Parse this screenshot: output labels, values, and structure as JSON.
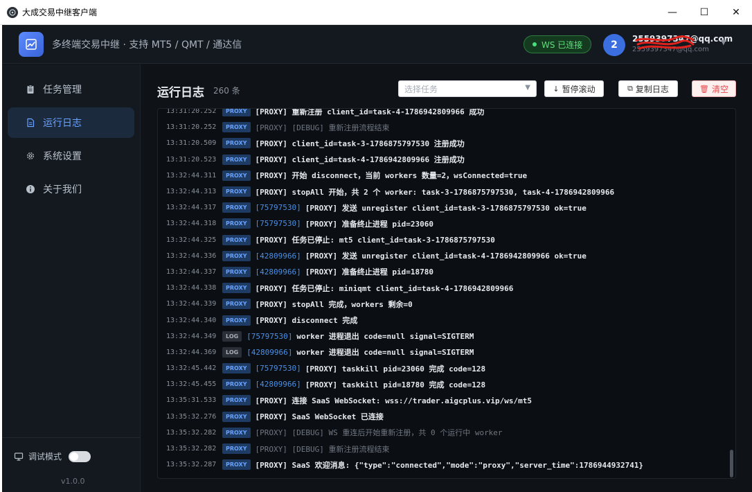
{
  "window": {
    "title": "大成交易中继客户端",
    "controls": [
      "—",
      "☐",
      "✕"
    ]
  },
  "header": {
    "title": "多终端交易中继 · 支持 MT5 / QMT / 通达信",
    "ws_status": "WS 已连接",
    "avatar_text": "2",
    "email_primary": "2559397347@qq.com",
    "email_secondary": "2559397347@qq.com"
  },
  "sidebar": {
    "items": [
      {
        "label": "任务管理",
        "icon": "clipboard-icon",
        "active": false
      },
      {
        "label": "运行日志",
        "icon": "document-icon",
        "active": true
      },
      {
        "label": "系统设置",
        "icon": "gear-icon",
        "active": false
      },
      {
        "label": "关于我们",
        "icon": "info-icon",
        "active": false
      }
    ],
    "debug_label": "调试模式",
    "debug_enabled": false,
    "version": "v1.0.0"
  },
  "main": {
    "title": "运行日志",
    "count": "260 条",
    "task_select_placeholder": "选择任务",
    "pause_label": "暂停滚动",
    "copy_label": "复制日志",
    "clear_label": "清空"
  },
  "logs": [
    {
      "time": "13:31:20.252",
      "tag": "PROXY",
      "src": "",
      "msg": "[PROXY] 重新注册 client_id=task-4-1786942809966 成功",
      "dim": false
    },
    {
      "time": "13:31:20.252",
      "tag": "PROXY",
      "src": "",
      "msg": "[PROXY] [DEBUG] 重新注册流程结束",
      "dim": true
    },
    {
      "time": "13:31:20.509",
      "tag": "PROXY",
      "src": "",
      "msg": "[PROXY] client_id=task-3-1786875797530 注册成功",
      "dim": false
    },
    {
      "time": "13:31:20.523",
      "tag": "PROXY",
      "src": "",
      "msg": "[PROXY] client_id=task-4-1786942809966 注册成功",
      "dim": false
    },
    {
      "time": "13:32:44.311",
      "tag": "PROXY",
      "src": "",
      "msg": "[PROXY] 开始 disconnect，当前 workers 数量=2，wsConnected=true",
      "dim": false
    },
    {
      "time": "13:32:44.313",
      "tag": "PROXY",
      "src": "",
      "msg": "[PROXY] stopAll 开始，共 2 个 worker: task-3-1786875797530, task-4-1786942809966",
      "dim": false
    },
    {
      "time": "13:32:44.317",
      "tag": "PROXY",
      "src": "[75797530]",
      "msg": "[PROXY] 发送 unregister client_id=task-3-1786875797530 ok=true",
      "dim": false
    },
    {
      "time": "13:32:44.318",
      "tag": "PROXY",
      "src": "[75797530]",
      "msg": "[PROXY] 准备终止进程 pid=23060",
      "dim": false
    },
    {
      "time": "13:32:44.325",
      "tag": "PROXY",
      "src": "",
      "msg": "[PROXY] 任务已停止: mt5 client_id=task-3-1786875797530",
      "dim": false
    },
    {
      "time": "13:32:44.336",
      "tag": "PROXY",
      "src": "[42809966]",
      "msg": "[PROXY] 发送 unregister client_id=task-4-1786942809966 ok=true",
      "dim": false
    },
    {
      "time": "13:32:44.337",
      "tag": "PROXY",
      "src": "[42809966]",
      "msg": "[PROXY] 准备终止进程 pid=18780",
      "dim": false
    },
    {
      "time": "13:32:44.338",
      "tag": "PROXY",
      "src": "",
      "msg": "[PROXY] 任务已停止: miniqmt client_id=task-4-1786942809966",
      "dim": false
    },
    {
      "time": "13:32:44.339",
      "tag": "PROXY",
      "src": "",
      "msg": "[PROXY] stopAll 完成，workers 剩余=0",
      "dim": false
    },
    {
      "time": "13:32:44.340",
      "tag": "PROXY",
      "src": "",
      "msg": "[PROXY] disconnect 完成",
      "dim": false
    },
    {
      "time": "13:32:44.349",
      "tag": "LOG",
      "src": "[75797530]",
      "msg": "worker 进程退出 code=null signal=SIGTERM",
      "dim": false
    },
    {
      "time": "13:32:44.369",
      "tag": "LOG",
      "src": "[42809966]",
      "msg": "worker 进程退出 code=null signal=SIGTERM",
      "dim": false
    },
    {
      "time": "13:32:45.442",
      "tag": "PROXY",
      "src": "[75797530]",
      "msg": "[PROXY] taskkill pid=23060 完成 code=128",
      "dim": false
    },
    {
      "time": "13:32:45.455",
      "tag": "PROXY",
      "src": "[42809966]",
      "msg": "[PROXY] taskkill pid=18780 完成 code=128",
      "dim": false
    },
    {
      "time": "13:35:31.533",
      "tag": "PROXY",
      "src": "",
      "msg": "[PROXY] 连接 SaaS WebSocket: wss://trader.aigcplus.vip/ws/mt5",
      "dim": false
    },
    {
      "time": "13:35:32.276",
      "tag": "PROXY",
      "src": "",
      "msg": "[PROXY] SaaS WebSocket 已连接",
      "dim": false
    },
    {
      "time": "13:35:32.282",
      "tag": "PROXY",
      "src": "",
      "msg": "[PROXY] [DEBUG] WS 重连后开始重新注册，共 0 个运行中 worker",
      "dim": true
    },
    {
      "time": "13:35:32.282",
      "tag": "PROXY",
      "src": "",
      "msg": "[PROXY] [DEBUG] 重新注册流程结束",
      "dim": true
    },
    {
      "time": "13:35:32.287",
      "tag": "PROXY",
      "src": "",
      "msg": "[PROXY] SaaS 欢迎消息: {\"type\":\"connected\",\"mode\":\"proxy\",\"server_time\":1786944932741}",
      "dim": false
    }
  ]
}
